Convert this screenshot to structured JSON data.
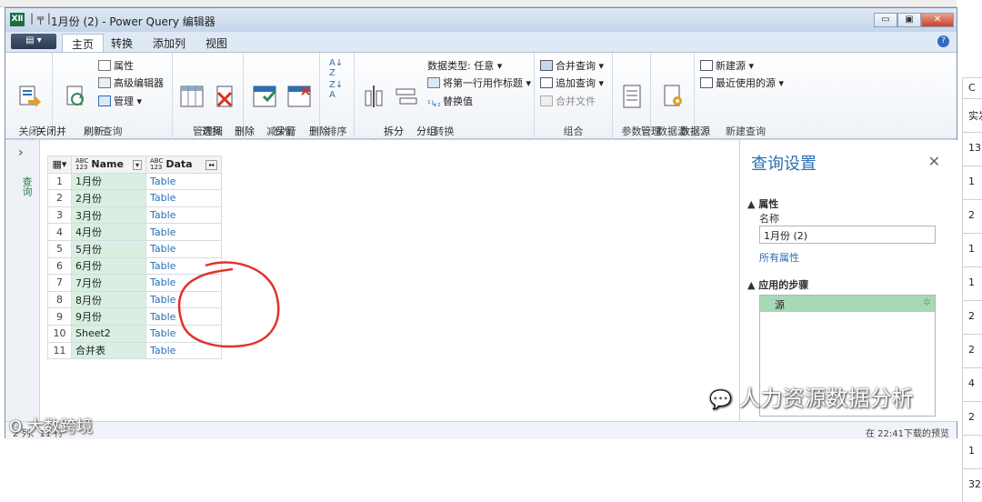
{
  "titlebar": {
    "app_icon": "XⅡ",
    "qat": "|  ╤  |",
    "title": "1月份 (2) - Power Query 编辑器",
    "min": "▭",
    "max": "▣",
    "close": "✕"
  },
  "menu": {
    "file": "▤ ▾",
    "tabs": [
      "主页",
      "转换",
      "添加列",
      "视图"
    ],
    "help": "?"
  },
  "ribbon": {
    "groups": {
      "close": {
        "label": "关闭",
        "btn": "关闭并\n上载▾"
      },
      "query": {
        "label": "查询",
        "refresh": "刷新\n预览▾",
        "properties": "属性",
        "advanced": "高级编辑器",
        "manage": "管理 ▾"
      },
      "columns": {
        "label": "管理列",
        "choose": "选择\n列▾",
        "remove": "删除\n列▾"
      },
      "rows": {
        "label": "减少行",
        "keep": "保留\n行▾",
        "remove": "删除\n行▾"
      },
      "sort": {
        "label": "排序"
      },
      "transform": {
        "label": "转换",
        "split": "拆分\n列▾",
        "group": "分组\n依据",
        "datatype": "数据类型: 任意 ▾",
        "first_row": "将第一行用作标题 ▾",
        "replace": "替换值"
      },
      "combine": {
        "label": "组合",
        "merge": "合并查询 ▾",
        "append": "追加查询 ▾",
        "combine_files": "合并文件"
      },
      "params": {
        "label": "参数",
        "manage": "管理\n参数▾"
      },
      "datasource": {
        "label": "数据源",
        "settings": "数据源\n设置"
      },
      "newquery": {
        "label": "新建查询",
        "new_source": "新建源 ▾",
        "recent": "最近使用的源 ▾"
      }
    }
  },
  "query_pane": {
    "arrow": "›",
    "label": "查询"
  },
  "grid": {
    "col_type_label": "ABC\n123",
    "columns": [
      "Name",
      "Data"
    ],
    "rows": [
      [
        "1",
        "1月份",
        "Table"
      ],
      [
        "2",
        "2月份",
        "Table"
      ],
      [
        "3",
        "3月份",
        "Table"
      ],
      [
        "4",
        "4月份",
        "Table"
      ],
      [
        "5",
        "5月份",
        "Table"
      ],
      [
        "6",
        "6月份",
        "Table"
      ],
      [
        "7",
        "7月份",
        "Table"
      ],
      [
        "8",
        "8月份",
        "Table"
      ],
      [
        "9",
        "9月份",
        "Table"
      ],
      [
        "10",
        "Sheet2",
        "Table"
      ],
      [
        "11",
        "合并表",
        "Table"
      ]
    ]
  },
  "settings": {
    "title": "查询设置",
    "close": "✕",
    "properties_heading": "▲ 属性",
    "name_label": "名称",
    "name_value": "1月份 (2)",
    "all_properties": "所有属性",
    "steps_heading": "▲ 应用的步骤",
    "steps": [
      "源"
    ]
  },
  "status": {
    "left": "2 列、11 行",
    "right": "在 22:41下载的预览"
  },
  "watermarks": {
    "right": "人力资源数据分析",
    "left": "大数跨境"
  },
  "background_sheet": {
    "cells": [
      "C",
      "实发",
      "13",
      "1",
      "2",
      "1",
      "1",
      "2",
      "2",
      "4",
      "2",
      "1",
      "32"
    ]
  }
}
